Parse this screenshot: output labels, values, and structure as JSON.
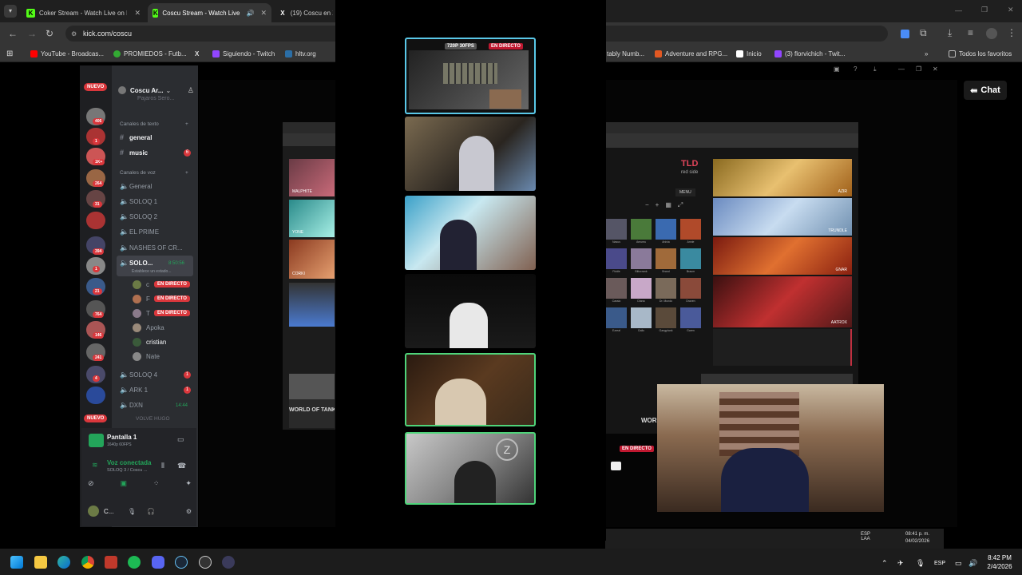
{
  "browser": {
    "tabs": [
      {
        "title": "Coker Stream - Watch Live on K"
      },
      {
        "title": "Coscu Stream - Watch Live"
      },
      {
        "title": "(19) Coscu en X"
      }
    ],
    "url": "kick.com/coscu",
    "bookmarks": [
      {
        "label": "YouTube - Broadcas..."
      },
      {
        "label": "PROMIEDOS - Futb..."
      },
      {
        "label": "Siguiendo - Twitch"
      },
      {
        "label": "hltv.org"
      },
      {
        "label": "tably Numb..."
      },
      {
        "label": "Adventure and RPG..."
      },
      {
        "label": "Inicio"
      },
      {
        "label": "(3) florvichich - Twit..."
      },
      {
        "label": "Todos los favoritos"
      }
    ]
  },
  "discord": {
    "server_name": "Coscu Ar...",
    "top_fade": "Pajaros Sero...",
    "new_badge": "NUEVO",
    "section_text": "Canales de texto",
    "text_channels": [
      {
        "name": "general"
      },
      {
        "name": "music",
        "badge": "6"
      }
    ],
    "section_voice": "Canales de voz",
    "voice_channels": [
      {
        "name": "General"
      },
      {
        "name": "SOLOQ 1"
      },
      {
        "name": "SOLOQ 2"
      },
      {
        "name": "EL PRIME"
      },
      {
        "name": "NASHES OF CR..."
      },
      {
        "name": "SOLO...",
        "timer": "8:50:56",
        "status": "Establece un estado..."
      }
    ],
    "voice_users": [
      {
        "name": "c",
        "live": "EN DIRECTO"
      },
      {
        "name": "F",
        "live": "EN DIRECTO"
      },
      {
        "name": "T",
        "live": "EN DIRECTO"
      },
      {
        "name": "Apoka"
      },
      {
        "name": "cristian"
      },
      {
        "name": "Nate"
      }
    ],
    "more_channels": [
      {
        "name": "SOLOQ 4",
        "badge": "1"
      },
      {
        "name": "ARK 1",
        "badge": "1"
      },
      {
        "name": "DXN",
        "timer": "14:44"
      },
      {
        "name": "VOLVE HUGO"
      }
    ],
    "guild_badges": [
      "406",
      "1",
      "1K+",
      "264",
      "31",
      "394",
      "1",
      "21",
      "764",
      "146",
      "241",
      "4"
    ],
    "bottom_new_badge": "NUEVO",
    "screen_share": {
      "title": "Pantalla 1",
      "sub": "1640p 60FPS"
    },
    "voice": {
      "status": "Voz conectada",
      "channel": "SOLOQ 3 / Coscu ..."
    },
    "user": {
      "name": "C..."
    }
  },
  "overlay": {
    "quality_label": "720P 30FPS",
    "live_label": "EN DIRECTO"
  },
  "stream": {
    "team": "TLD",
    "side": "red side",
    "menu_label": "MENU",
    "champions": [
      "AZIR",
      "TRUNDLE",
      "GNAR",
      "AATROX"
    ],
    "left_champions": [
      "MALPHITE",
      "YONE",
      "CORKI"
    ],
    "world_of_tanks": "WORLD OF TANKS",
    "world_partial": "WORL",
    "live_label": "EN DIRECTO",
    "grid_labels": [
      "Nasus",
      "Amumu",
      "Anivia",
      "Annie",
      "Fiddle",
      "Blitzcrank",
      "Brand",
      "Braum",
      "Cassio",
      "Diana",
      "Dr. Mundo",
      "Draven",
      "Ezreal",
      "Galio",
      "Gangplank",
      "Garen"
    ],
    "chat_label": "Chat",
    "inner_lang": "ESP\nLAA",
    "inner_time": "08:41 p. m.",
    "inner_date": "04/02/2026"
  },
  "taskbar": {
    "lang": "ESP",
    "time": "8:42 PM",
    "date": "2/4/2026"
  },
  "colors": {
    "kick_green": "#53fc18",
    "discord_bg": "#2b2d31",
    "live_red": "#da373c",
    "cam_highlight": "#5ac8e8",
    "cam_green": "#4fd47a"
  }
}
